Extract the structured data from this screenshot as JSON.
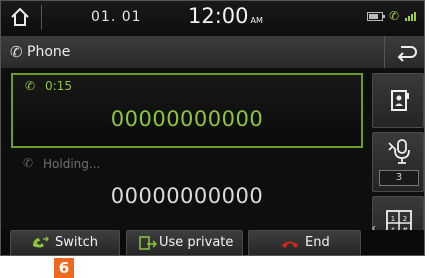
{
  "status_bar": {
    "date": "01. 01",
    "time": "12:00",
    "ampm": "AM"
  },
  "header": {
    "title": "Phone"
  },
  "active_call": {
    "duration": "0:15",
    "number": "00000000000"
  },
  "held_call": {
    "status": "Holding...",
    "number": "00000000000"
  },
  "side": {
    "volume_level": "3"
  },
  "bottom": {
    "switch_label": "Switch",
    "private_label": "Use private",
    "end_label": "End"
  },
  "callout": {
    "number": "6"
  },
  "colors": {
    "accent_green": "#8cc63f",
    "end_red": "#d9241b",
    "callout_orange": "#ee6a1e"
  }
}
